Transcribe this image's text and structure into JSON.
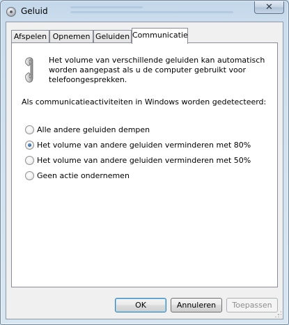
{
  "window": {
    "title": "Geluid",
    "close_symbol": "✕"
  },
  "tabs": [
    {
      "label": "Afspelen",
      "active": false
    },
    {
      "label": "Opnemen",
      "active": false
    },
    {
      "label": "Geluiden",
      "active": false
    },
    {
      "label": "Communicatie",
      "active": true
    }
  ],
  "communication": {
    "icon": "telephone-icon",
    "description": "Het volume van verschillende geluiden kan automatisch worden aangepast als u de computer gebruikt voor telefoongesprekken.",
    "detected_label": "Als communicatieactiviteiten in Windows worden gedetecteerd:",
    "options": [
      {
        "label": "Alle andere geluiden dempen",
        "checked": false
      },
      {
        "label": "Het volume van andere geluiden verminderen met 80%",
        "checked": true
      },
      {
        "label": "Het volume van andere geluiden verminderen met 50%",
        "checked": false
      },
      {
        "label": "Geen actie ondernemen",
        "checked": false
      }
    ]
  },
  "buttons": {
    "ok": "OK",
    "cancel": "Annuleren",
    "apply": "Toepassen"
  }
}
